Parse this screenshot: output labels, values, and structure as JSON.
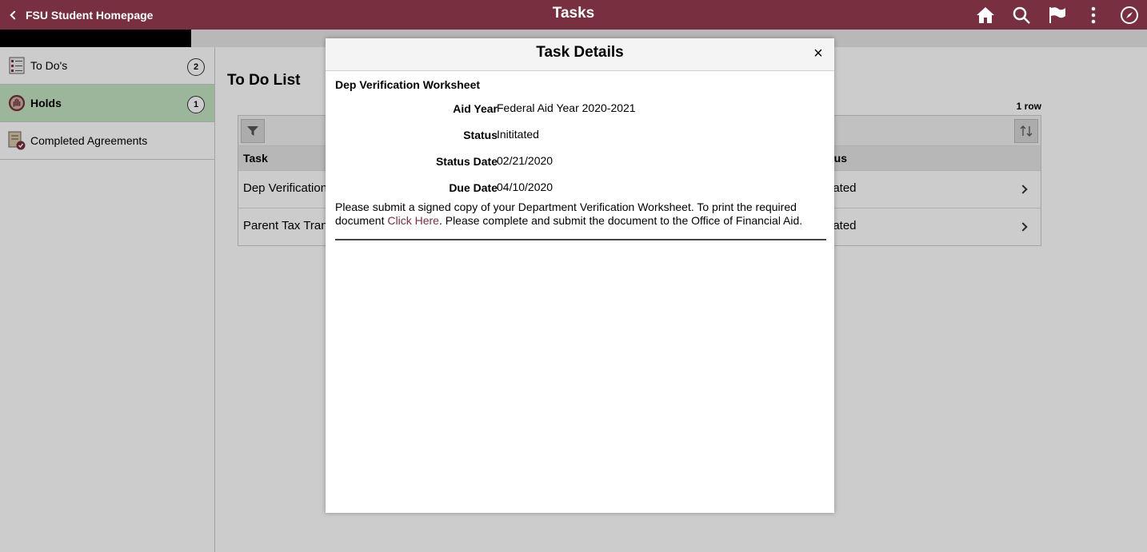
{
  "header": {
    "back_label": "FSU Student Homepage",
    "title": "Tasks",
    "icons": [
      "home-icon",
      "search-icon",
      "flag-icon",
      "more-icon",
      "compass-icon"
    ]
  },
  "sidebar": {
    "items": [
      {
        "label": "To Do's",
        "badge": "2",
        "icon": "checklist-icon",
        "active": false
      },
      {
        "label": "Holds",
        "badge": "1",
        "icon": "hand-stop-icon",
        "active": true
      },
      {
        "label": "Completed Agreements",
        "badge": "",
        "icon": "agreement-icon",
        "active": false
      }
    ]
  },
  "main": {
    "title": "To Do List",
    "row_count": "1 row",
    "columns": {
      "task": "Task",
      "status": "tus"
    },
    "rows": [
      {
        "task": "Dep Verification",
        "status": "iated"
      },
      {
        "task": "Parent Tax Tran",
        "status": "iated"
      }
    ]
  },
  "modal": {
    "title": "Task Details",
    "close_label": "×",
    "task_name": "Dep Verification Worksheet",
    "details": [
      {
        "label": "Aid Year",
        "value": "Federal Aid Year 2020-2021"
      },
      {
        "label": "Status",
        "value": "Inititated"
      },
      {
        "label": "Status Date",
        "value": "02/21/2020"
      },
      {
        "label": "Due Date",
        "value": "04/10/2020"
      }
    ],
    "desc_before": "Please submit a signed copy of your Department Verification Worksheet. To print the required document ",
    "link_text": "Click Here",
    "desc_after": ". Please complete and submit the document to the Office of Financial Aid."
  },
  "colors": {
    "header": "#782f40",
    "active_item": "#c4e4c4",
    "link": "#782f40"
  }
}
